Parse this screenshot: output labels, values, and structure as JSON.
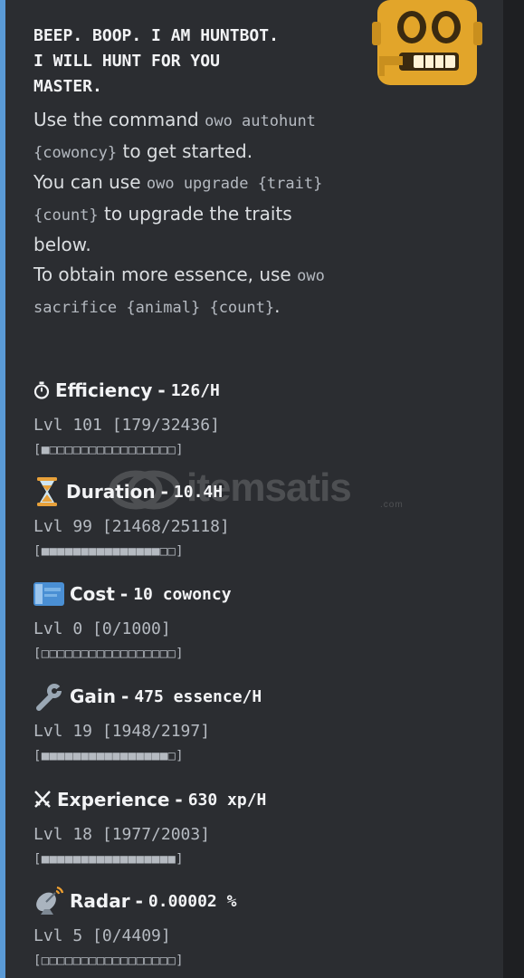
{
  "header": {
    "title": "BEEP. BOOP. I AM HUNTBOT.\nI WILL HUNT FOR YOU\nMASTER."
  },
  "intro": {
    "line1_text": "Use the command ",
    "line1_code": "owo autohunt {cowoncy}",
    "line1_end": " to get started.",
    "line2_text": "You can use ",
    "line2_code": "owo upgrade {trait} {count}",
    "line2_end": " to upgrade the traits below.",
    "line3_text": "To obtain more essence, use ",
    "line3_code": "owo sacrifice {animal} {count}",
    "line3_end": "."
  },
  "traits": [
    {
      "icon": "stopwatch-icon",
      "name": "Efficiency",
      "value": "126/H",
      "level": "Lvl 101 [179/32436]",
      "progress": 0.0055,
      "bar": "[■□□□□□□□□□□□□□□□□]"
    },
    {
      "icon": "hourglass-icon",
      "name": "Duration",
      "value": "10.4H",
      "level": "Lvl 99 [21468/25118]",
      "progress": 0.855,
      "bar": "[■■■■■■■■■■■■■■■□□]"
    },
    {
      "icon": "ticket-icon",
      "name": "Cost",
      "value": "10 cowoncy",
      "level": "Lvl 0 [0/1000]",
      "progress": 0,
      "bar": "[□□□□□□□□□□□□□□□□□]"
    },
    {
      "icon": "wrench-icon",
      "name": "Gain",
      "value": "475 essence/H",
      "level": "Lvl 19 [1948/2197]",
      "progress": 0.887,
      "bar": "[■■■■■■■■■■■■■■■■□]"
    },
    {
      "icon": "crossed-swords-icon",
      "name": "Experience",
      "value": "630 xp/H",
      "level": "Lvl 18 [1977/2003]",
      "progress": 0.987,
      "bar": "[■■■■■■■■■■■■■■■■■]"
    },
    {
      "icon": "satellite-dish-icon",
      "name": "Radar",
      "value": "0.00002 %",
      "level": "Lvl 5 [0/4409]",
      "progress": 0,
      "bar": "[□□□□□□□□□□□□□□□□□]"
    }
  ],
  "separator": " - ",
  "colors": {
    "embed_bg": "#2b2d31",
    "embed_border": "#5a9ad6",
    "bot_gold": "#e2a52a"
  },
  "watermark": {
    "text": "itemsatis",
    "suffix": ".com"
  }
}
